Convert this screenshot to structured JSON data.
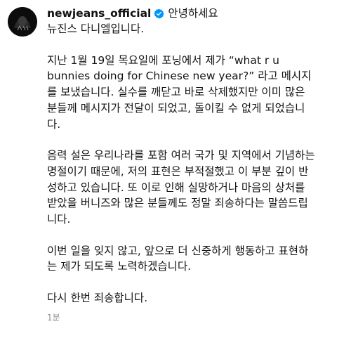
{
  "post": {
    "username": "newjeans_official",
    "verified_icon": "verified-check-icon",
    "avatar_icon": "profile-avatar-icon",
    "accent_color": "#0095f6",
    "caption": {
      "greeting": "안녕하세요",
      "intro": "뉴진스 다니엘입니다.",
      "paragraphs": [
        "지난 1월 19일 목요일에 포닝에서 제가 “what r u\nbunnies doing for Chinese new year?” 라고 메시지\n를 보냈습니다. 실수를 깨닫고 바로 삭제했지만 이미 많은\n분들께 메시지가 전달이 되었고, 돌이킬 수 없게 되었습니\n다.",
        "음력 설은 우리나라를 포함 여러 국가 및 지역에서 기념하는\n명절이기 때문에, 저의 표현은 부적절했고 이 부분 깊이 반\n성하고 있습니다. 또 이로 인해 실망하거나 마음의 상처를\n받았을 버니즈와 많은 분들께도 정말 죄송하다는 말씀드립\n니다.",
        "이번 일을 잊지 않고, 앞으로 더 신중하게 행동하고 표현하\n는 제가 되도록 노력하겠습니다.",
        "다시 한번 죄송합니다."
      ]
    },
    "timestamp": "1분"
  }
}
